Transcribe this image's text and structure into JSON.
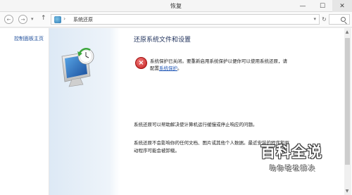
{
  "window": {
    "title": "恢复"
  },
  "nav": {
    "address_current": "系统还原",
    "back_glyph": "←",
    "forward_glyph": "→",
    "up_glyph": "↑",
    "sep_glyph": "›",
    "caret_glyph": "▾",
    "refresh_glyph": "↻"
  },
  "sidebar": {
    "control_panel_link": "控制面板主页"
  },
  "main": {
    "heading": "还原系统文件和设置",
    "error_line1": "系统保护已关闭。要重新启用系统保护以便你可以使用系统还原，请",
    "error_line2_prefix": "配置",
    "error_link": "系统保护",
    "error_line2_suffix": "。",
    "description1": "系统还原可以帮助解决使计算机运行缓慢或停止响应的问题。",
    "description2": "系统还原不会影响你的任何文档、图片或其他个人数据。最近安装的程序和驱",
    "description3": "动程序可能会被卸载。"
  },
  "watermark": {
    "title": "百科全说",
    "subtitle": "助你轻松解决"
  },
  "icons": {
    "error": "error-x-icon",
    "minimize": "minimize-icon",
    "maximize": "maximize-icon",
    "close": "close-icon"
  },
  "colors": {
    "link": "#1e55b5",
    "heading": "#1d2f5a",
    "error": "#c41e1e"
  }
}
